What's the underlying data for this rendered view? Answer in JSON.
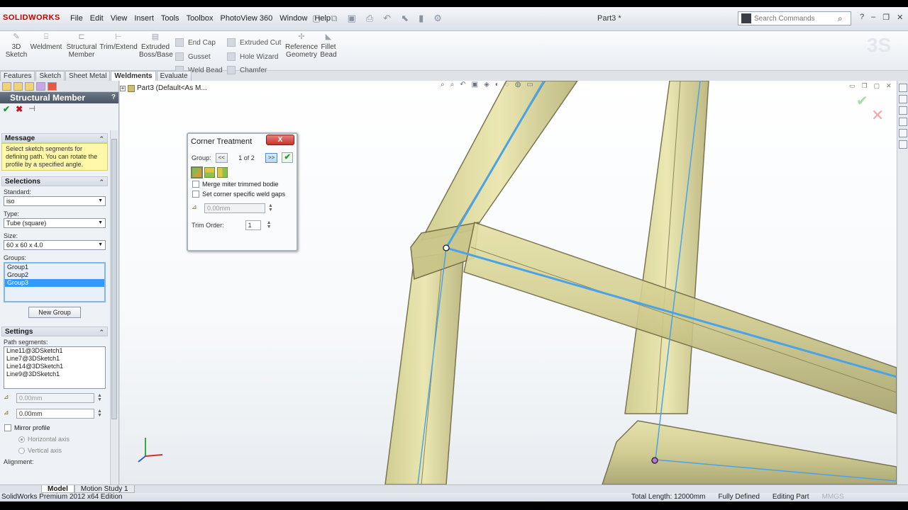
{
  "app": {
    "logo": "SOLIDWORKS",
    "document_title": "Part3 *",
    "edition": "SolidWorks Premium 2012 x64 Edition"
  },
  "menu": [
    "File",
    "Edit",
    "View",
    "Insert",
    "Tools",
    "Toolbox",
    "PhotoView 360",
    "Window",
    "Help"
  ],
  "search": {
    "placeholder": "Search Commands"
  },
  "command_manager": {
    "sketch3d": "3D Sketch",
    "weldment": "Weldment",
    "structural_member": "Structural Member",
    "trim_extend": "Trim/Extend",
    "extruded_boss": "Extruded Boss/Base",
    "end_cap": "End Cap",
    "gusset": "Gusset",
    "weld_bead": "Weld Bead",
    "extruded_cut": "Extruded Cut",
    "hole_wizard": "Hole Wizard",
    "chamfer": "Chamfer",
    "reference_geometry": "Reference Geometry",
    "fillet_bead": "Fillet Bead"
  },
  "tabs": [
    "Features",
    "Sketch",
    "Sheet Metal",
    "Weldments",
    "Evaluate"
  ],
  "property_manager": {
    "title": "Structural Member",
    "help": "?",
    "message_title": "Message",
    "message": "Select sketch segments for defining path. You can rotate the profile by a specified angle.",
    "selections_title": "Selections",
    "standard_label": "Standard:",
    "standard_value": "iso",
    "type_label": "Type:",
    "type_value": "Tube (square)",
    "size_label": "Size:",
    "size_value": "60 x 60 x 4.0",
    "groups_label": "Groups:",
    "groups": [
      "Group1",
      "Group2",
      "Group3"
    ],
    "new_group": "New Group",
    "settings_title": "Settings",
    "path_segments_label": "Path segments:",
    "path_segments": [
      "Line11@3DSketch1",
      "Line7@3DSketch1",
      "Line14@3DSketch1",
      "Line9@3DSketch1"
    ],
    "gap1": "0.00mm",
    "gap2": "0.00mm",
    "mirror_profile": "Mirror profile",
    "horizontal_axis": "Horizontal axis",
    "vertical_axis": "Vertical axis",
    "alignment_label": "Alignment:"
  },
  "tree": {
    "item": "Part3  (Default<As M..."
  },
  "corner_treatment": {
    "title": "Corner Treatment",
    "close": "X",
    "group_label": "Group:",
    "prev": "<<",
    "counter": "1 of 2",
    "next": ">>",
    "merge_label": "Merge miter trimmed bodie",
    "weld_gap_label": "Set corner specific weld gaps",
    "gap_value": "0.00mm",
    "trim_order_label": "Trim Order:",
    "trim_order_value": "1"
  },
  "bottom_tabs": [
    "Model",
    "Motion Study 1"
  ],
  "status": {
    "total_length": "Total Length: 12000mm",
    "state": "Fully Defined",
    "mode": "Editing Part",
    "units": "MMGS"
  },
  "colors": {
    "tube_fill": "#d8d39a",
    "tube_edge": "#6f6a44",
    "path_line": "#4aa3e6",
    "selection": "#3399ff"
  }
}
